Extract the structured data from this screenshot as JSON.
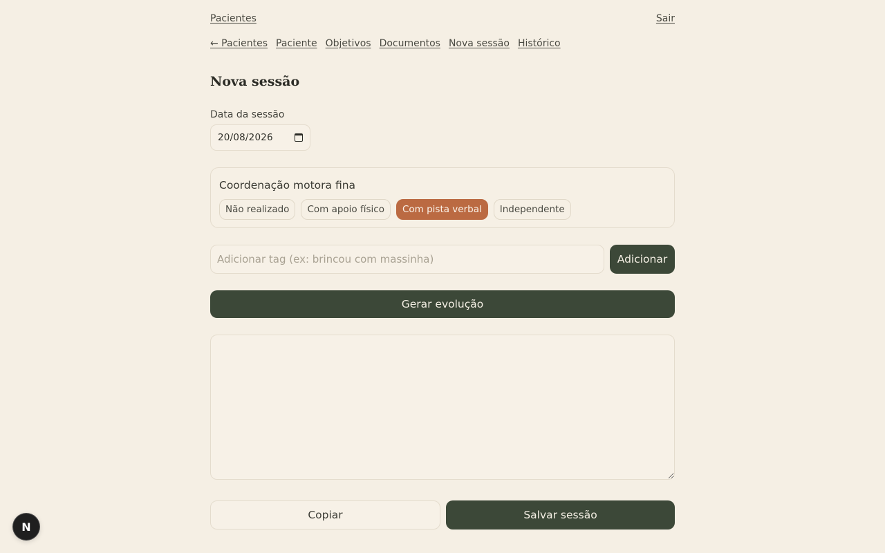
{
  "topbar": {
    "patients_link": "Pacientes",
    "logout_link": "Sair"
  },
  "subnav": {
    "items": [
      {
        "label": "← Pacientes"
      },
      {
        "label": "Paciente"
      },
      {
        "label": "Objetivos"
      },
      {
        "label": "Documentos"
      },
      {
        "label": "Nova sessão"
      },
      {
        "label": "Histórico"
      }
    ]
  },
  "page": {
    "title": "Nova sessão"
  },
  "session_date": {
    "label": "Data da sessão",
    "value": "20/08/2026"
  },
  "goal": {
    "title": "Coordenação motora fina",
    "options": [
      {
        "label": "Não realizado",
        "selected": false
      },
      {
        "label": "Com apoio físico",
        "selected": false
      },
      {
        "label": "Com pista verbal",
        "selected": true
      },
      {
        "label": "Independente",
        "selected": false
      }
    ]
  },
  "tag": {
    "placeholder": "Adicionar tag (ex: brincou com massinha)",
    "value": "",
    "add_label": "Adicionar"
  },
  "generate": {
    "label": "Gerar evolução"
  },
  "notes": {
    "value": ""
  },
  "actions": {
    "copy_label": "Copiar",
    "save_label": "Salvar sessão"
  },
  "dev_badge": {
    "letter": "N"
  },
  "colors": {
    "background": "#f5efe4",
    "primary": "#3c4838",
    "accent": "#bb6a42"
  }
}
